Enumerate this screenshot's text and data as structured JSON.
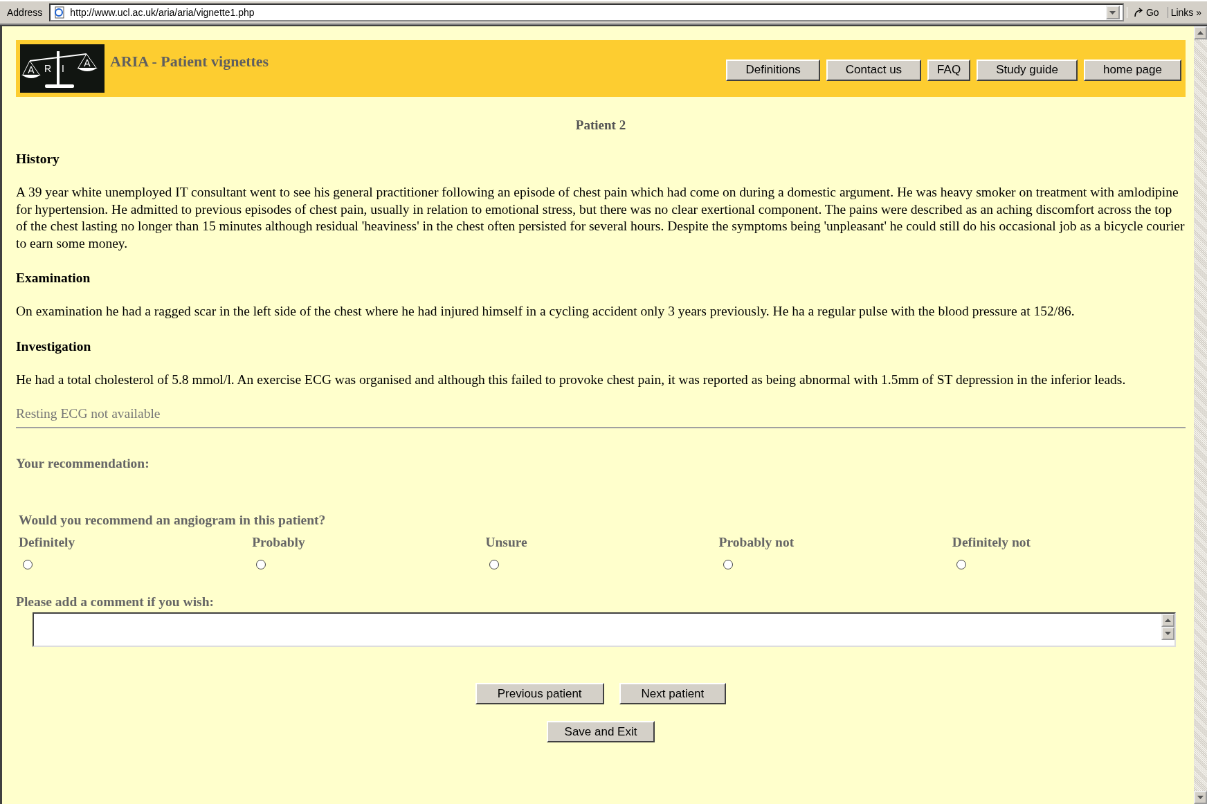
{
  "browser": {
    "address_label": "Address",
    "url": "http://www.ucl.ac.uk/aria/aria/vignette1.php",
    "go_label": "Go",
    "links_label": "Links",
    "links_more": "»"
  },
  "header": {
    "title": "ARIA - Patient vignettes",
    "logo_letters": [
      "A",
      "R",
      "I",
      "A"
    ],
    "nav_buttons": [
      "Definitions",
      "Contact us",
      "FAQ",
      "Study guide",
      "home page"
    ]
  },
  "patient_title": "Patient 2",
  "sections": [
    {
      "heading": "History",
      "text": "A 39 year white unemployed IT consultant went to see his general practitioner following an episode of chest pain which had come on during a domestic argument. He was heavy smoker on treatment with amlodipine for hypertension. He admitted to previous episodes of chest pain, usually in relation to emotional stress, but there was no clear exertional component. The pains were described as an aching discomfort across the top of the chest lasting no longer than 15 minutes although residual 'heaviness' in the chest often persisted for several hours. Despite the symptoms being 'unpleasant' he could still do his occasional job as a bicycle courier to earn some money."
    },
    {
      "heading": "Examination",
      "text": "On examination he had a ragged scar in the left side of the chest where he had injured himself in a cycling accident only 3 years previously. He ha a regular pulse with the blood pressure at 152/86."
    },
    {
      "heading": "Investigation",
      "text": "He had a total cholesterol of 5.8 mmol/l. An exercise ECG was organised and although this failed to provoke chest pain, it was reported as being abnormal with 1.5mm of ST depression in the inferior leads."
    }
  ],
  "ecg_note": "Resting ECG not available",
  "recommendation": {
    "heading": "Your recommendation:",
    "question": "Would you recommend an angiogram in this patient?",
    "options": [
      {
        "label": "Definitely",
        "selected": false
      },
      {
        "label": "Probably",
        "selected": false
      },
      {
        "label": "Unsure",
        "selected": false
      },
      {
        "label": "Probably not",
        "selected": false
      },
      {
        "label": "Definitely not",
        "selected": false
      }
    ],
    "comment_label": "Please add a comment if you wish:"
  },
  "nav_buttons": [
    "Previous patient",
    "Next patient"
  ],
  "save_button": "Save and Exit"
}
